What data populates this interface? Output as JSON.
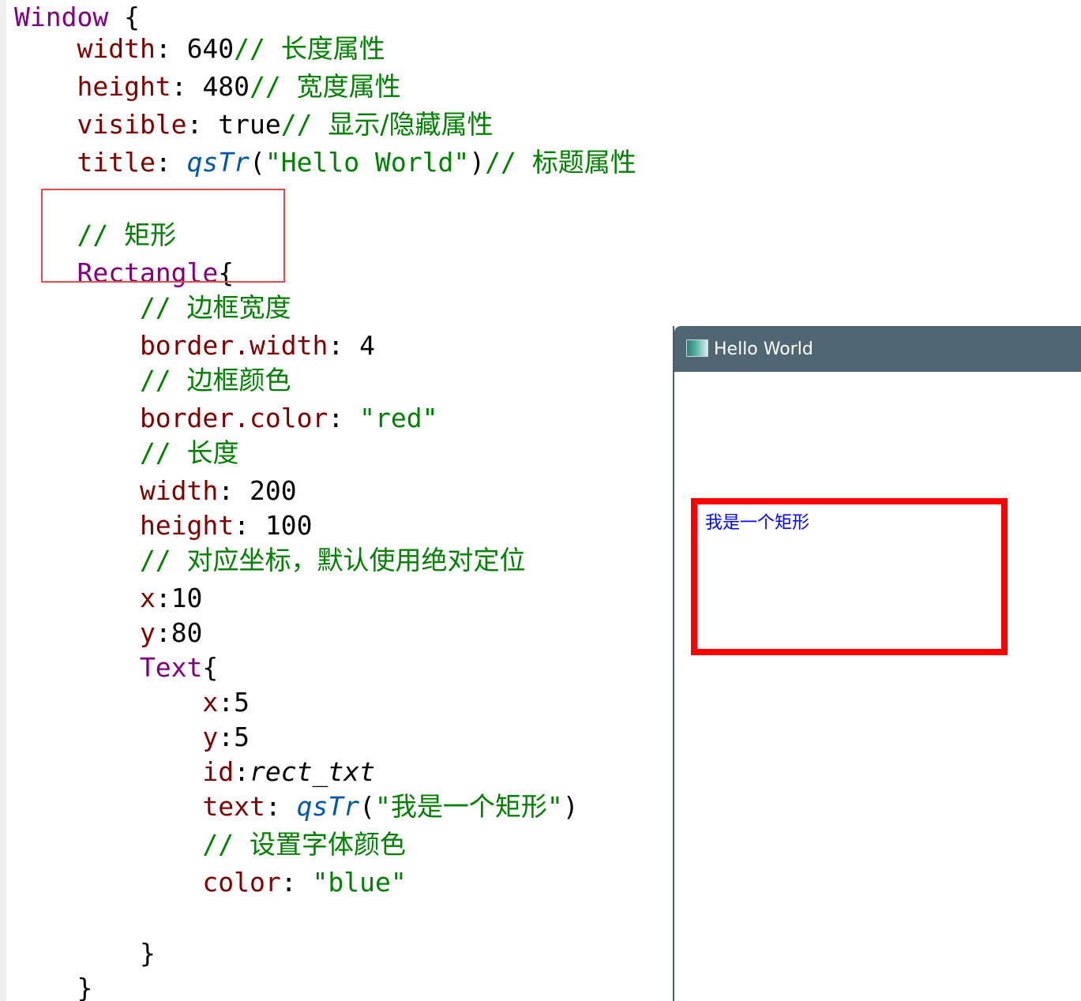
{
  "editor": {
    "lines": [
      {
        "segments": [
          {
            "text": "Window",
            "cls": "kw"
          },
          {
            "text": " {",
            "cls": "punct"
          }
        ]
      },
      {
        "segments": [
          {
            "text": "    width",
            "cls": "prop"
          },
          {
            "text": ": ",
            "cls": "punct"
          },
          {
            "text": "640",
            "cls": "num"
          },
          {
            "text": "// ",
            "cls": "cmt"
          },
          {
            "text": "长度属性",
            "cls": "cmt-cn"
          }
        ]
      },
      {
        "segments": [
          {
            "text": "    height",
            "cls": "prop"
          },
          {
            "text": ": ",
            "cls": "punct"
          },
          {
            "text": "480",
            "cls": "num"
          },
          {
            "text": "// ",
            "cls": "cmt"
          },
          {
            "text": "宽度属性",
            "cls": "cmt-cn"
          }
        ]
      },
      {
        "segments": [
          {
            "text": "    visible",
            "cls": "prop"
          },
          {
            "text": ": ",
            "cls": "punct"
          },
          {
            "text": "true",
            "cls": "num"
          },
          {
            "text": "// ",
            "cls": "cmt"
          },
          {
            "text": "显示/隐藏属性",
            "cls": "cmt-cn"
          }
        ]
      },
      {
        "segments": [
          {
            "text": "    title",
            "cls": "prop"
          },
          {
            "text": ": ",
            "cls": "punct"
          },
          {
            "text": "qsTr",
            "cls": "fn"
          },
          {
            "text": "(",
            "cls": "punct"
          },
          {
            "text": "\"Hello World\"",
            "cls": "str"
          },
          {
            "text": ")",
            "cls": "punct"
          },
          {
            "text": "// ",
            "cls": "cmt"
          },
          {
            "text": "标题属性",
            "cls": "cmt-cn"
          }
        ]
      },
      {
        "segments": []
      },
      {
        "segments": [
          {
            "text": "    // ",
            "cls": "cmt"
          },
          {
            "text": "矩形",
            "cls": "cmt-cn"
          }
        ]
      },
      {
        "segments": [
          {
            "text": "    Rectangle",
            "cls": "kw"
          },
          {
            "text": "{",
            "cls": "punct"
          }
        ]
      },
      {
        "segments": [
          {
            "text": "        // ",
            "cls": "cmt"
          },
          {
            "text": "边框宽度",
            "cls": "cmt-cn"
          }
        ]
      },
      {
        "segments": [
          {
            "text": "        border.width",
            "cls": "prop"
          },
          {
            "text": ": ",
            "cls": "punct"
          },
          {
            "text": "4",
            "cls": "num"
          }
        ]
      },
      {
        "segments": [
          {
            "text": "        // ",
            "cls": "cmt"
          },
          {
            "text": "边框颜色",
            "cls": "cmt-cn"
          }
        ]
      },
      {
        "segments": [
          {
            "text": "        border.color",
            "cls": "prop"
          },
          {
            "text": ": ",
            "cls": "punct"
          },
          {
            "text": "\"red\"",
            "cls": "str"
          }
        ]
      },
      {
        "segments": [
          {
            "text": "        // ",
            "cls": "cmt"
          },
          {
            "text": "长度",
            "cls": "cmt-cn"
          }
        ]
      },
      {
        "segments": [
          {
            "text": "        width",
            "cls": "prop"
          },
          {
            "text": ": ",
            "cls": "punct"
          },
          {
            "text": "200",
            "cls": "num"
          }
        ]
      },
      {
        "segments": [
          {
            "text": "        height",
            "cls": "prop"
          },
          {
            "text": ": ",
            "cls": "punct"
          },
          {
            "text": "100",
            "cls": "num"
          }
        ]
      },
      {
        "segments": [
          {
            "text": "        // ",
            "cls": "cmt"
          },
          {
            "text": "对应坐标，默认使用绝对定位",
            "cls": "cmt-cn"
          }
        ]
      },
      {
        "segments": [
          {
            "text": "        x",
            "cls": "prop"
          },
          {
            "text": ":",
            "cls": "punct"
          },
          {
            "text": "10",
            "cls": "num"
          }
        ]
      },
      {
        "segments": [
          {
            "text": "        y",
            "cls": "prop"
          },
          {
            "text": ":",
            "cls": "punct"
          },
          {
            "text": "80",
            "cls": "num"
          }
        ]
      },
      {
        "segments": [
          {
            "text": "        Text",
            "cls": "kw"
          },
          {
            "text": "{",
            "cls": "punct"
          }
        ]
      },
      {
        "segments": [
          {
            "text": "            x",
            "cls": "prop"
          },
          {
            "text": ":",
            "cls": "punct"
          },
          {
            "text": "5",
            "cls": "num"
          }
        ]
      },
      {
        "segments": [
          {
            "text": "            y",
            "cls": "prop"
          },
          {
            "text": ":",
            "cls": "punct"
          },
          {
            "text": "5",
            "cls": "num"
          }
        ]
      },
      {
        "segments": [
          {
            "text": "            id",
            "cls": "prop"
          },
          {
            "text": ":",
            "cls": "punct"
          },
          {
            "text": "rect_txt",
            "cls": "ital"
          }
        ]
      },
      {
        "segments": [
          {
            "text": "            text",
            "cls": "prop"
          },
          {
            "text": ": ",
            "cls": "punct"
          },
          {
            "text": "qsTr",
            "cls": "fn"
          },
          {
            "text": "(",
            "cls": "punct"
          },
          {
            "text": "\"我是一个矩形\"",
            "cls": "str"
          },
          {
            "text": ")",
            "cls": "punct"
          }
        ]
      },
      {
        "segments": [
          {
            "text": "            // ",
            "cls": "cmt"
          },
          {
            "text": "设置字体颜色",
            "cls": "cmt-cn"
          }
        ]
      },
      {
        "segments": [
          {
            "text": "            color",
            "cls": "prop"
          },
          {
            "text": ": ",
            "cls": "punct"
          },
          {
            "text": "\"blue\"",
            "cls": "str"
          }
        ]
      },
      {
        "segments": []
      },
      {
        "segments": [
          {
            "text": "        }",
            "cls": "punct"
          }
        ]
      },
      {
        "segments": [
          {
            "text": "    }",
            "cls": "punct"
          }
        ]
      }
    ]
  },
  "app_window": {
    "title": "Hello World",
    "rect_text": "我是一个矩形"
  },
  "colors": {
    "keyword": "#800080",
    "property": "#800000",
    "comment": "#008000",
    "function": "#0057ae",
    "rect_border": "#ff0000",
    "rect_text": "#0000ff",
    "titlebar": "#516673"
  }
}
